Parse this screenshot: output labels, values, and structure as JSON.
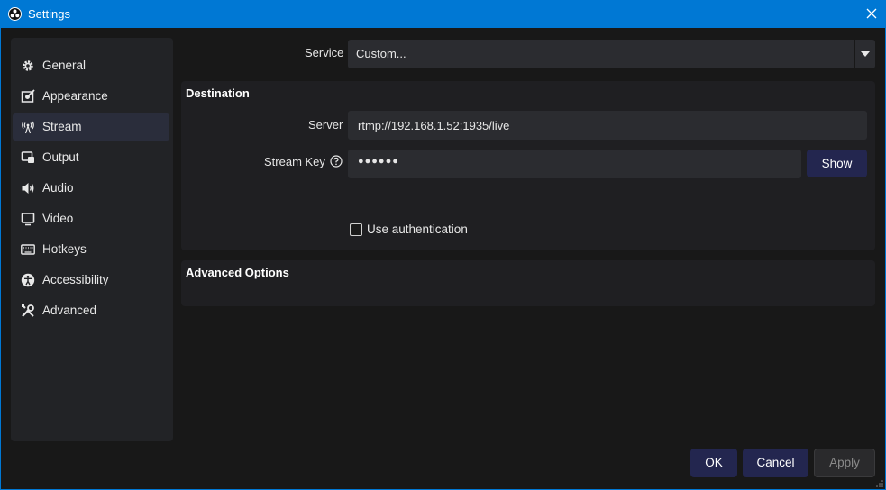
{
  "window": {
    "title": "Settings"
  },
  "sidebar": {
    "items": [
      {
        "label": "General",
        "icon": "gear-icon"
      },
      {
        "label": "Appearance",
        "icon": "appearance-icon"
      },
      {
        "label": "Stream",
        "icon": "antenna-icon",
        "active": true
      },
      {
        "label": "Output",
        "icon": "output-icon"
      },
      {
        "label": "Audio",
        "icon": "speaker-icon"
      },
      {
        "label": "Video",
        "icon": "monitor-icon"
      },
      {
        "label": "Hotkeys",
        "icon": "keyboard-icon"
      },
      {
        "label": "Accessibility",
        "icon": "accessibility-icon"
      },
      {
        "label": "Advanced",
        "icon": "tools-icon"
      }
    ]
  },
  "stream": {
    "service_label": "Service",
    "service_value": "Custom...",
    "destination_title": "Destination",
    "server_label": "Server",
    "server_value": "rtmp://192.168.1.52:1935/live",
    "stream_key_label": "Stream Key",
    "stream_key_value": "●●●●●●",
    "show_button": "Show",
    "use_auth_label": "Use authentication",
    "use_auth_checked": false,
    "advanced_title": "Advanced Options"
  },
  "footer": {
    "ok": "OK",
    "cancel": "Cancel",
    "apply": "Apply"
  },
  "colors": {
    "titlebar": "#0078d4",
    "background": "#181818",
    "panel": "#1f1f22",
    "button": "#23264f",
    "active_nav": "#2a2d3b"
  }
}
